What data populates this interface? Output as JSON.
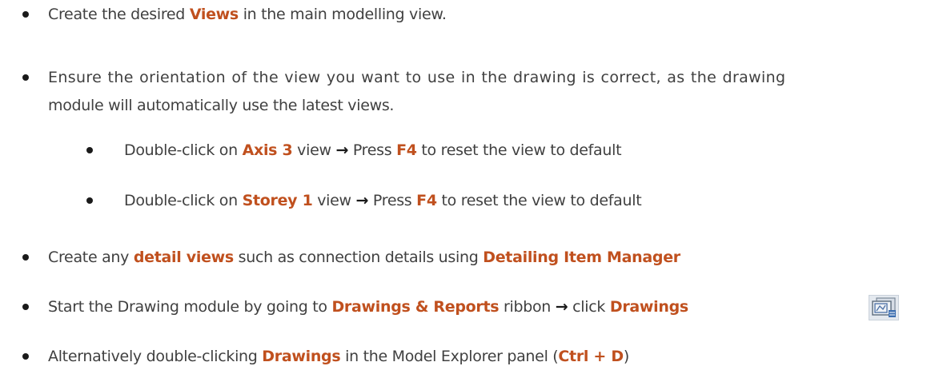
{
  "items": [
    {
      "parts": [
        {
          "t": "Create the desired "
        },
        {
          "t": "Views",
          "hl": true
        },
        {
          "t": " in the main modelling view."
        }
      ]
    },
    {
      "parts": [
        {
          "t": "Ensure the orientation of the view you want to use in the drawing is correct, as the drawing"
        }
      ],
      "cont": [
        {
          "t": "module will automatically use the latest views."
        }
      ]
    },
    {
      "parts": [
        {
          "t": "Double-click on "
        },
        {
          "t": "Axis 3",
          "hl": true
        },
        {
          "t": " view "
        },
        {
          "t": "→",
          "arrow": true
        },
        {
          "t": " Press "
        },
        {
          "t": "F4",
          "hl": true
        },
        {
          "t": " to reset the view to default"
        }
      ]
    },
    {
      "parts": [
        {
          "t": "Double-click on "
        },
        {
          "t": "Storey 1",
          "hl": true
        },
        {
          "t": " view "
        },
        {
          "t": "→",
          "arrow": true
        },
        {
          "t": " Press "
        },
        {
          "t": "F4",
          "hl": true
        },
        {
          "t": " to reset the view to default"
        }
      ]
    },
    {
      "parts": [
        {
          "t": "Create any "
        },
        {
          "t": "detail views",
          "hl": true
        },
        {
          "t": " such as connection details using "
        },
        {
          "t": "Detailing Item Manager",
          "hl": true
        }
      ]
    },
    {
      "parts": [
        {
          "t": "Start the Drawing module by going to "
        },
        {
          "t": "Drawings & Reports",
          "hl": true
        },
        {
          "t": " ribbon "
        },
        {
          "t": "→",
          "arrow": true
        },
        {
          "t": " click "
        },
        {
          "t": "Drawings",
          "hl": true
        }
      ]
    },
    {
      "parts": [
        {
          "t": "Alternatively double-clicking "
        },
        {
          "t": "Drawings",
          "hl": true
        },
        {
          "t": " in the Model Explorer panel ("
        },
        {
          "t": "Ctrl + D",
          "hl": true
        },
        {
          "t": ")"
        }
      ]
    }
  ],
  "icons": {
    "drawings_icon": "drawings-icon"
  }
}
